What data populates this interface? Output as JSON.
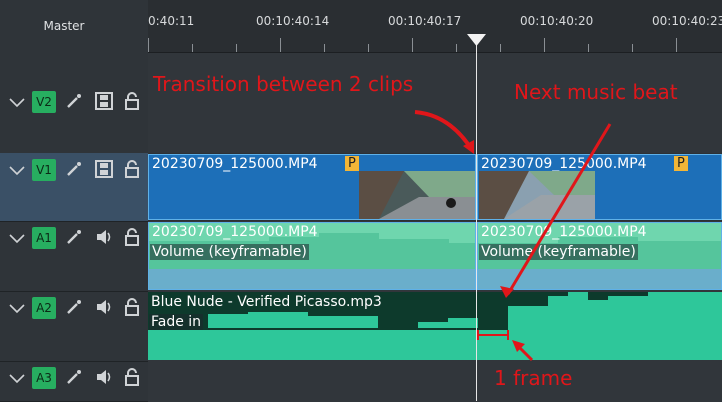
{
  "header": {
    "master_label": "Master"
  },
  "ruler": {
    "timecodes": [
      "0:40:11",
      "00:10:40:14",
      "00:10:40:17",
      "00:10:40:20",
      "00:10:40:23"
    ]
  },
  "tracks": [
    {
      "id": "V2",
      "type": "video"
    },
    {
      "id": "V1",
      "type": "video"
    },
    {
      "id": "A1",
      "type": "audio"
    },
    {
      "id": "A2",
      "type": "audio"
    },
    {
      "id": "A3",
      "type": "audio"
    }
  ],
  "clips": {
    "v1_left": {
      "title": "20230709_125000.MP4",
      "badge": "P"
    },
    "v1_right": {
      "title": "20230709_125000.MP4",
      "badge": "P"
    },
    "a1_left": {
      "title": "20230709_125000.MP4",
      "effect": "Volume (keyframable)"
    },
    "a1_right": {
      "title": "20230709_125000.MP4",
      "effect": "Volume (keyframable)"
    },
    "a2_music": {
      "title": "Blue Nude - Verified Picasso.mp3",
      "effect": "Fade in"
    }
  },
  "annotations": {
    "transition": "Transition between 2 clips",
    "beat": "Next music beat",
    "frame": "1 frame"
  },
  "colors": {
    "video_clip": "#1d6fb8",
    "audio_clip": "#3fd0a0",
    "track_badge": "#27ae60",
    "annotation": "#e0161a",
    "p_badge": "#f3b637"
  },
  "icons": [
    "chevron-down-icon",
    "effect-wand-icon",
    "film-icon",
    "speaker-icon",
    "lock-icon"
  ]
}
